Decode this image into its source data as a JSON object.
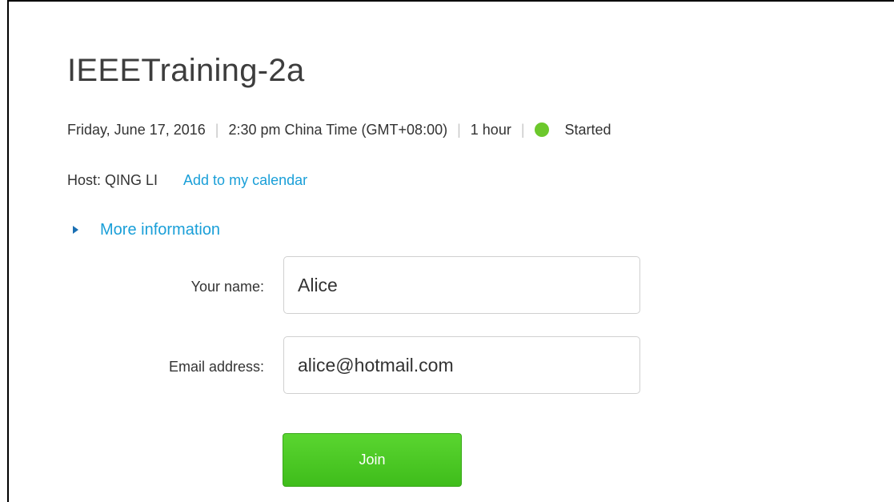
{
  "meeting": {
    "title": "IEEETraining-2a",
    "date": "Friday, June 17, 2016",
    "time": "2:30 pm China Time (GMT+08:00)",
    "duration": "1 hour",
    "status": "Started",
    "status_color": "#6cc82c",
    "host_label": "Host: QING LI",
    "add_calendar_label": "Add to my calendar",
    "more_info_label": "More information"
  },
  "form": {
    "name_label": "Your name:",
    "name_value": "Alice",
    "email_label": "Email address:",
    "email_value": "alice@hotmail.com",
    "join_label": "Join"
  },
  "icons": {
    "expand": "triangle-right-icon",
    "status": "status-dot-icon"
  },
  "colors": {
    "link": "#1a9fd8",
    "join_button": "#4cc926"
  }
}
